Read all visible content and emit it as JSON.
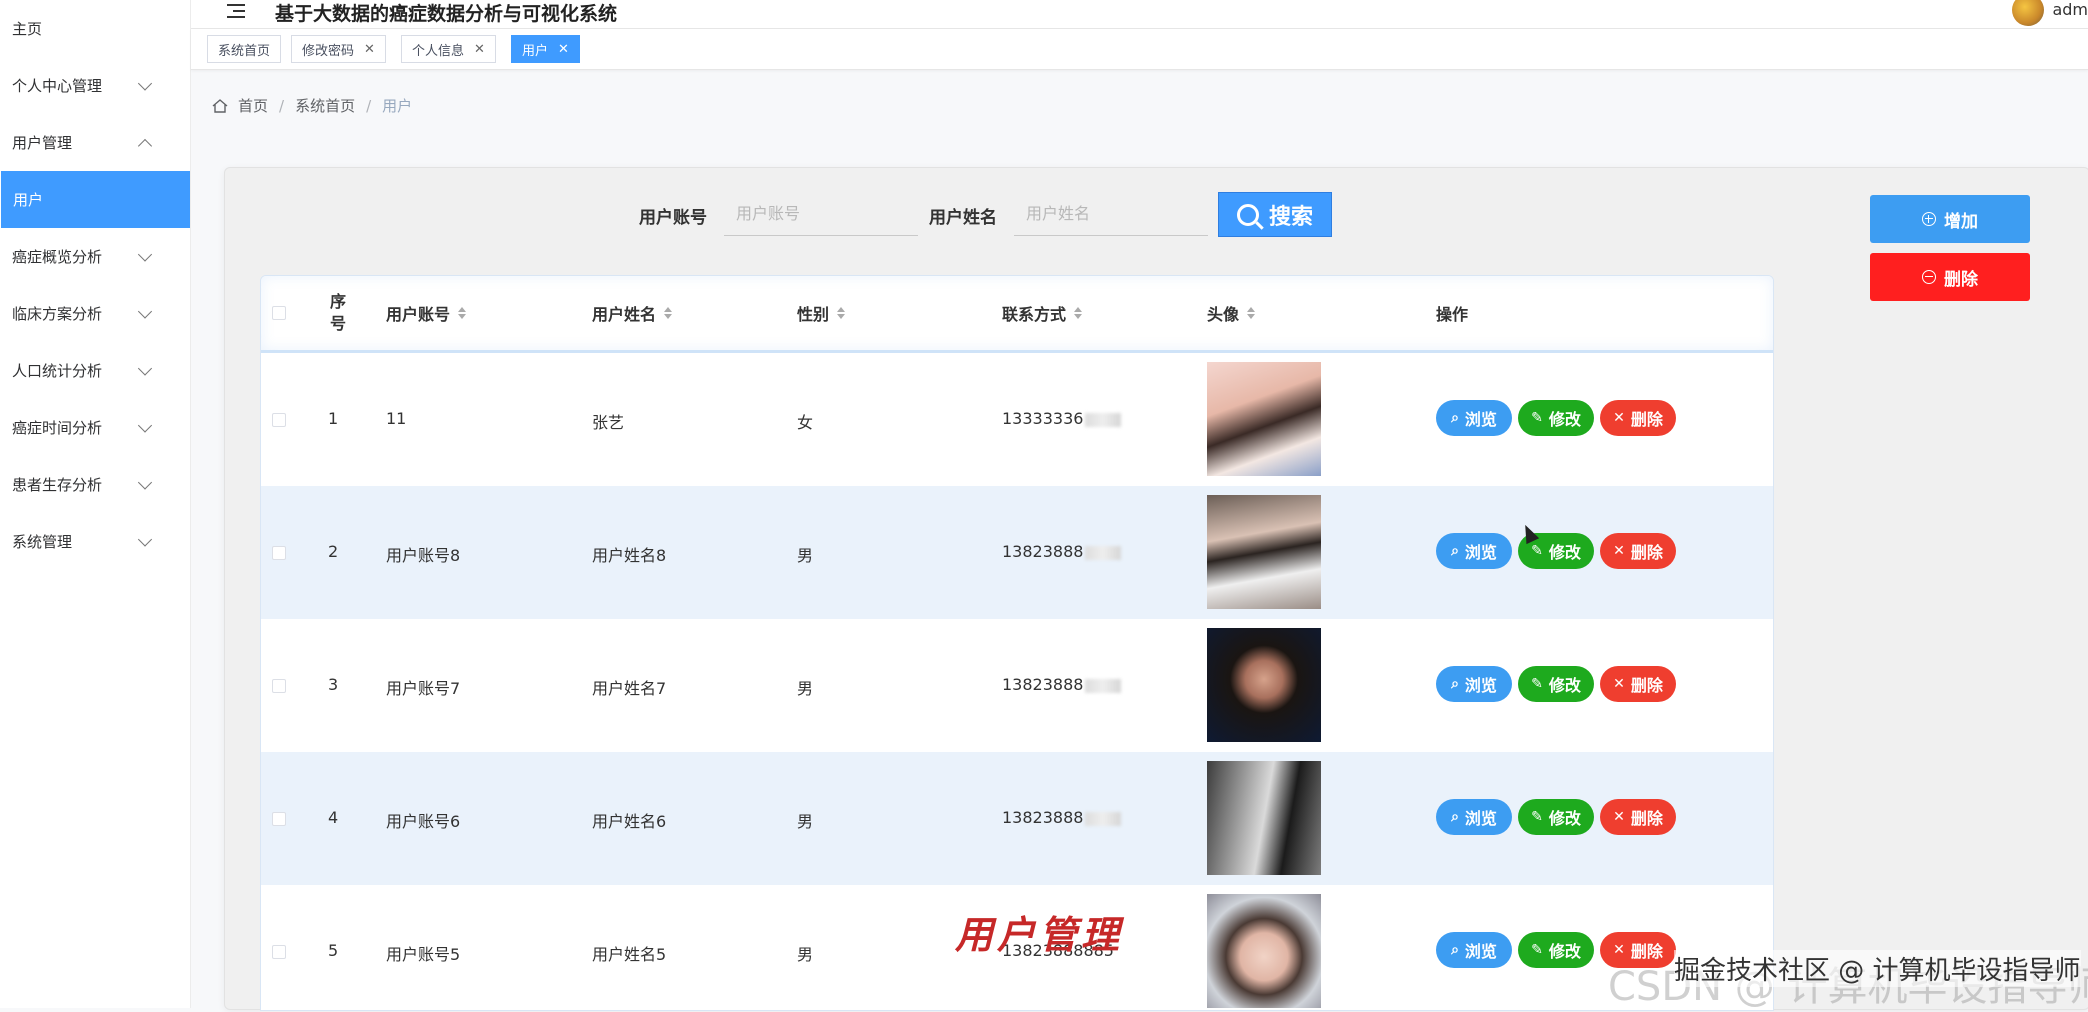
{
  "app": {
    "title": "基于大数据的癌症数据分析与可视化系统",
    "user_name": "adm"
  },
  "sidebar": {
    "items": [
      {
        "label": "主页",
        "chevron": "none"
      },
      {
        "label": "个人中心管理",
        "chevron": "down"
      },
      {
        "label": "用户管理",
        "chevron": "up"
      },
      {
        "label": "用户",
        "chevron": "none",
        "active": true
      },
      {
        "label": "癌症概览分析",
        "chevron": "down"
      },
      {
        "label": "临床方案分析",
        "chevron": "down"
      },
      {
        "label": "人口统计分析",
        "chevron": "down"
      },
      {
        "label": "癌症时间分析",
        "chevron": "down"
      },
      {
        "label": "患者生存分析",
        "chevron": "down"
      },
      {
        "label": "系统管理",
        "chevron": "down"
      }
    ]
  },
  "tabs": [
    {
      "label": "系统首页",
      "closable": false
    },
    {
      "label": "修改密码",
      "closable": true
    },
    {
      "label": "个人信息",
      "closable": true
    },
    {
      "label": "用户",
      "closable": true,
      "active": true
    }
  ],
  "tab_close_glyph": "✕",
  "breadcrumb": {
    "items": [
      "首页",
      "系统首页",
      "用户"
    ],
    "separator": "/"
  },
  "search": {
    "account_label": "用户账号",
    "account_placeholder": "用户账号",
    "name_label": "用户姓名",
    "name_placeholder": "用户姓名",
    "button_label": "搜索"
  },
  "actions": {
    "add_label": "增加",
    "delete_label": "删除"
  },
  "table": {
    "headers": {
      "index": "序号",
      "account": "用户账号",
      "name": "用户姓名",
      "gender": "性别",
      "phone": "联系方式",
      "avatar": "头像",
      "ops": "操作"
    },
    "row_buttons": {
      "view": "浏览",
      "edit": "修改",
      "delete": "删除"
    },
    "rows": [
      {
        "index": "1",
        "account": "11",
        "name": "张艺",
        "gender": "女",
        "phone": "13333336"
      },
      {
        "index": "2",
        "account": "用户账号8",
        "name": "用户姓名8",
        "gender": "男",
        "phone": "13823888"
      },
      {
        "index": "3",
        "account": "用户账号7",
        "name": "用户姓名7",
        "gender": "男",
        "phone": "13823888"
      },
      {
        "index": "4",
        "account": "用户账号6",
        "name": "用户姓名6",
        "gender": "男",
        "phone": "13823888"
      },
      {
        "index": "5",
        "account": "用户账号5",
        "name": "用户姓名5",
        "gender": "男",
        "phone": "13823888885"
      }
    ]
  },
  "overlay": {
    "stamp": "用户管理",
    "watermark_1": "掘金技术社区 @ 计算机毕设指导师",
    "watermark_2": "CSDN @ 计算机毕设指导师"
  },
  "colors": {
    "accent": "#3f9bff",
    "edit": "#1eaa1e",
    "danger": "#ef3e2f"
  }
}
